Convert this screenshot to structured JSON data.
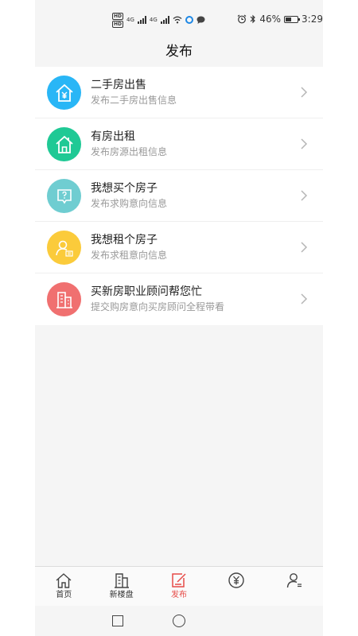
{
  "status_bar": {
    "hd1": "HD",
    "hd2": "HD",
    "net1": "4G",
    "net2": "4G",
    "battery_percent": "46%",
    "time": "3:29"
  },
  "header": {
    "title": "发布"
  },
  "menu": {
    "items": [
      {
        "title": "二手房出售",
        "subtitle": "发布二手房出售信息",
        "icon": "house-yuan-icon",
        "color": "#29b6f6"
      },
      {
        "title": "有房出租",
        "subtitle": "发布房源出租信息",
        "icon": "house-icon",
        "color": "#1fc995"
      },
      {
        "title": "我想买个房子",
        "subtitle": "发布求购意向信息",
        "icon": "question-bubble-icon",
        "color": "#6fcdd1"
      },
      {
        "title": "我想租个房子",
        "subtitle": "发布求租意向信息",
        "icon": "person-rent-icon",
        "color": "#fbcb3b"
      },
      {
        "title": "买新房职业顾问帮您忙",
        "subtitle": "提交购房意向买房顾问全程带看",
        "icon": "building-icon",
        "color": "#f07070"
      }
    ]
  },
  "tabbar": {
    "tabs": [
      {
        "label": "首页",
        "icon": "home-icon"
      },
      {
        "label": "新楼盘",
        "icon": "building-icon"
      },
      {
        "label": "发布",
        "icon": "edit-icon",
        "active": true
      },
      {
        "label": "",
        "icon": "yuan-circle-icon"
      },
      {
        "label": "",
        "icon": "user-icon"
      }
    ],
    "accent_color": "#e64b47"
  }
}
